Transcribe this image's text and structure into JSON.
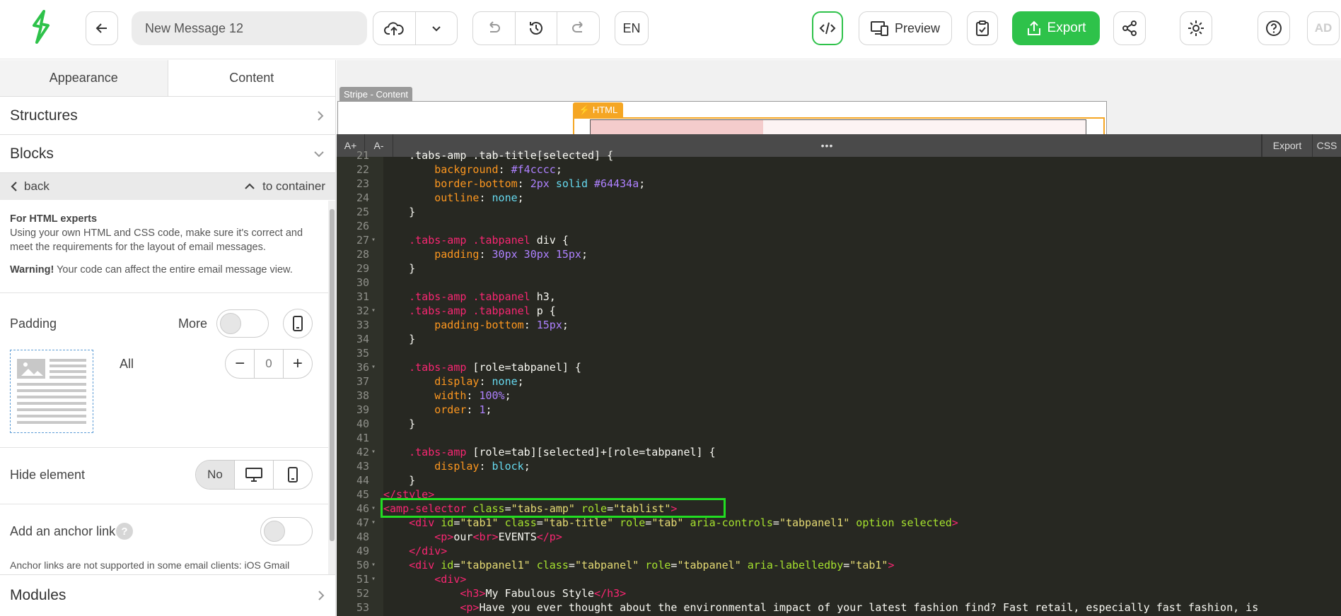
{
  "topbar": {
    "message_title": "New Message 12",
    "lang_label": "EN",
    "preview_label": "Preview",
    "export_label": "Export",
    "avatar_initials": "AD",
    "accent_color": "#2ec24a"
  },
  "panel": {
    "tabs": [
      "Appearance",
      "Content"
    ],
    "structures_label": "Structures",
    "blocks_label": "Blocks",
    "back_label": "back",
    "to_container_label": "to container",
    "info_title": "For HTML experts",
    "info_text": "Using your own HTML and CSS code, make sure it's correct and meet the requirements for the layout of email messages.",
    "warning_bold": "Warning!",
    "warning_text": " Your code can affect the entire email message view.",
    "padding_label": "Padding",
    "more_label": "More",
    "all_label": "All",
    "padding_value": "0",
    "hide_element_label": "Hide element",
    "hide_no_label": "No",
    "anchor_label": "Add an anchor link",
    "anchor_help": "?",
    "anchor_note": "Anchor links are not supported in some email clients: iOS Gmail",
    "modules_label": "Modules"
  },
  "canvas": {
    "stripe_tag": "Stripe - Content",
    "html_tag": "HTML"
  },
  "editor": {
    "font_up": "A+",
    "font_down": "A-",
    "dots": "•••",
    "export_btn": "Export",
    "css_btn": "CSS",
    "lines": [
      {
        "n": "21",
        "fold": "",
        "segs": [
          {
            "t": "    .tabs-amp .tab-title[selected] {",
            "c": "#f8f8f2"
          }
        ]
      },
      {
        "n": "22",
        "fold": "",
        "segs": [
          {
            "t": "        ",
            "c": "#f8f8f2"
          },
          {
            "t": "background",
            "c": "#fd971f"
          },
          {
            "t": ": ",
            "c": "#f8f8f2"
          },
          {
            "t": "#f4cccc",
            "c": "#ae81ff"
          },
          {
            "t": ";",
            "c": "#f8f8f2"
          }
        ]
      },
      {
        "n": "23",
        "fold": "",
        "segs": [
          {
            "t": "        ",
            "c": "#f8f8f2"
          },
          {
            "t": "border-bottom",
            "c": "#fd971f"
          },
          {
            "t": ": ",
            "c": "#f8f8f2"
          },
          {
            "t": "2px",
            "c": "#ae81ff"
          },
          {
            "t": " solid ",
            "c": "#66d9ef"
          },
          {
            "t": "#64434a",
            "c": "#ae81ff"
          },
          {
            "t": ";",
            "c": "#f8f8f2"
          }
        ]
      },
      {
        "n": "24",
        "fold": "",
        "segs": [
          {
            "t": "        ",
            "c": "#f8f8f2"
          },
          {
            "t": "outline",
            "c": "#fd971f"
          },
          {
            "t": ": ",
            "c": "#f8f8f2"
          },
          {
            "t": "none",
            "c": "#66d9ef"
          },
          {
            "t": ";",
            "c": "#f8f8f2"
          }
        ]
      },
      {
        "n": "25",
        "fold": "",
        "segs": [
          {
            "t": "    }",
            "c": "#f8f8f2"
          }
        ]
      },
      {
        "n": "26",
        "fold": "",
        "segs": [
          {
            "t": "",
            "c": "#f8f8f2"
          }
        ]
      },
      {
        "n": "27",
        "fold": "▾",
        "segs": [
          {
            "t": "    ",
            "c": "#f8f8f2"
          },
          {
            "t": ".tabs-amp",
            "c": "#f92672"
          },
          {
            "t": " ",
            "c": "#f8f8f2"
          },
          {
            "t": ".tabpanel",
            "c": "#f92672"
          },
          {
            "t": " div {",
            "c": "#f8f8f2"
          }
        ]
      },
      {
        "n": "28",
        "fold": "",
        "segs": [
          {
            "t": "        ",
            "c": "#f8f8f2"
          },
          {
            "t": "padding",
            "c": "#fd971f"
          },
          {
            "t": ": ",
            "c": "#f8f8f2"
          },
          {
            "t": "30px 30px 15px",
            "c": "#ae81ff"
          },
          {
            "t": ";",
            "c": "#f8f8f2"
          }
        ]
      },
      {
        "n": "29",
        "fold": "",
        "segs": [
          {
            "t": "    }",
            "c": "#f8f8f2"
          }
        ]
      },
      {
        "n": "30",
        "fold": "",
        "segs": [
          {
            "t": "",
            "c": "#f8f8f2"
          }
        ]
      },
      {
        "n": "31",
        "fold": "",
        "segs": [
          {
            "t": "    ",
            "c": "#f8f8f2"
          },
          {
            "t": ".tabs-amp",
            "c": "#f92672"
          },
          {
            "t": " ",
            "c": "#f8f8f2"
          },
          {
            "t": ".tabpanel",
            "c": "#f92672"
          },
          {
            "t": " h3,",
            "c": "#f8f8f2"
          }
        ]
      },
      {
        "n": "32",
        "fold": "▾",
        "segs": [
          {
            "t": "    ",
            "c": "#f8f8f2"
          },
          {
            "t": ".tabs-amp",
            "c": "#f92672"
          },
          {
            "t": " ",
            "c": "#f8f8f2"
          },
          {
            "t": ".tabpanel",
            "c": "#f92672"
          },
          {
            "t": " p {",
            "c": "#f8f8f2"
          }
        ]
      },
      {
        "n": "33",
        "fold": "",
        "segs": [
          {
            "t": "        ",
            "c": "#f8f8f2"
          },
          {
            "t": "padding-bottom",
            "c": "#fd971f"
          },
          {
            "t": ": ",
            "c": "#f8f8f2"
          },
          {
            "t": "15px",
            "c": "#ae81ff"
          },
          {
            "t": ";",
            "c": "#f8f8f2"
          }
        ]
      },
      {
        "n": "34",
        "fold": "",
        "segs": [
          {
            "t": "    }",
            "c": "#f8f8f2"
          }
        ]
      },
      {
        "n": "35",
        "fold": "",
        "segs": [
          {
            "t": "",
            "c": "#f8f8f2"
          }
        ]
      },
      {
        "n": "36",
        "fold": "▾",
        "segs": [
          {
            "t": "    ",
            "c": "#f8f8f2"
          },
          {
            "t": ".tabs-amp",
            "c": "#f92672"
          },
          {
            "t": " [role=tabpanel] {",
            "c": "#f8f8f2"
          }
        ]
      },
      {
        "n": "37",
        "fold": "",
        "segs": [
          {
            "t": "        ",
            "c": "#f8f8f2"
          },
          {
            "t": "display",
            "c": "#fd971f"
          },
          {
            "t": ": ",
            "c": "#f8f8f2"
          },
          {
            "t": "none",
            "c": "#66d9ef"
          },
          {
            "t": ";",
            "c": "#f8f8f2"
          }
        ]
      },
      {
        "n": "38",
        "fold": "",
        "segs": [
          {
            "t": "        ",
            "c": "#f8f8f2"
          },
          {
            "t": "width",
            "c": "#fd971f"
          },
          {
            "t": ": ",
            "c": "#f8f8f2"
          },
          {
            "t": "100%",
            "c": "#ae81ff"
          },
          {
            "t": ";",
            "c": "#f8f8f2"
          }
        ]
      },
      {
        "n": "39",
        "fold": "",
        "segs": [
          {
            "t": "        ",
            "c": "#f8f8f2"
          },
          {
            "t": "order",
            "c": "#fd971f"
          },
          {
            "t": ": ",
            "c": "#f8f8f2"
          },
          {
            "t": "1",
            "c": "#ae81ff"
          },
          {
            "t": ";",
            "c": "#f8f8f2"
          }
        ]
      },
      {
        "n": "40",
        "fold": "",
        "segs": [
          {
            "t": "    }",
            "c": "#f8f8f2"
          }
        ]
      },
      {
        "n": "41",
        "fold": "",
        "segs": [
          {
            "t": "",
            "c": "#f8f8f2"
          }
        ]
      },
      {
        "n": "42",
        "fold": "▾",
        "segs": [
          {
            "t": "    ",
            "c": "#f8f8f2"
          },
          {
            "t": ".tabs-amp",
            "c": "#f92672"
          },
          {
            "t": " [role=tab][selected]+[role=tabpanel] {",
            "c": "#f8f8f2"
          }
        ]
      },
      {
        "n": "43",
        "fold": "",
        "segs": [
          {
            "t": "        ",
            "c": "#f8f8f2"
          },
          {
            "t": "display",
            "c": "#fd971f"
          },
          {
            "t": ": ",
            "c": "#f8f8f2"
          },
          {
            "t": "block",
            "c": "#66d9ef"
          },
          {
            "t": ";",
            "c": "#f8f8f2"
          }
        ]
      },
      {
        "n": "44",
        "fold": "",
        "segs": [
          {
            "t": "    }",
            "c": "#f8f8f2"
          }
        ]
      },
      {
        "n": "45",
        "fold": "",
        "segs": [
          {
            "t": "</style>",
            "c": "#f92672"
          }
        ]
      },
      {
        "n": "46",
        "fold": "▾",
        "segs": [
          {
            "t": "<amp-selector",
            "c": "#f92672"
          },
          {
            "t": " class",
            "c": "#a6e22e"
          },
          {
            "t": "=",
            "c": "#f8f8f2"
          },
          {
            "t": "\"tabs-amp\"",
            "c": "#e6db74"
          },
          {
            "t": " role",
            "c": "#a6e22e"
          },
          {
            "t": "=",
            "c": "#f8f8f2"
          },
          {
            "t": "\"tablist\"",
            "c": "#e6db74"
          },
          {
            "t": ">",
            "c": "#f92672"
          }
        ]
      },
      {
        "n": "47",
        "fold": "▾",
        "segs": [
          {
            "t": "    ",
            "c": "#f8f8f2"
          },
          {
            "t": "<div",
            "c": "#f92672"
          },
          {
            "t": " id",
            "c": "#a6e22e"
          },
          {
            "t": "=",
            "c": "#f8f8f2"
          },
          {
            "t": "\"tab1\"",
            "c": "#e6db74"
          },
          {
            "t": " class",
            "c": "#a6e22e"
          },
          {
            "t": "=",
            "c": "#f8f8f2"
          },
          {
            "t": "\"tab-title\"",
            "c": "#e6db74"
          },
          {
            "t": " role",
            "c": "#a6e22e"
          },
          {
            "t": "=",
            "c": "#f8f8f2"
          },
          {
            "t": "\"tab\"",
            "c": "#e6db74"
          },
          {
            "t": " aria-controls",
            "c": "#a6e22e"
          },
          {
            "t": "=",
            "c": "#f8f8f2"
          },
          {
            "t": "\"tabpanel1\"",
            "c": "#e6db74"
          },
          {
            "t": " option selected",
            "c": "#a6e22e"
          },
          {
            "t": ">",
            "c": "#f92672"
          }
        ]
      },
      {
        "n": "48",
        "fold": "",
        "segs": [
          {
            "t": "        ",
            "c": "#f8f8f2"
          },
          {
            "t": "<p>",
            "c": "#f92672"
          },
          {
            "t": "our",
            "c": "#f8f8f2"
          },
          {
            "t": "<br>",
            "c": "#f92672"
          },
          {
            "t": "EVENTS",
            "c": "#f8f8f2"
          },
          {
            "t": "</p>",
            "c": "#f92672"
          }
        ]
      },
      {
        "n": "49",
        "fold": "",
        "segs": [
          {
            "t": "    ",
            "c": "#f8f8f2"
          },
          {
            "t": "</div>",
            "c": "#f92672"
          }
        ]
      },
      {
        "n": "50",
        "fold": "▾",
        "segs": [
          {
            "t": "    ",
            "c": "#f8f8f2"
          },
          {
            "t": "<div",
            "c": "#f92672"
          },
          {
            "t": " id",
            "c": "#a6e22e"
          },
          {
            "t": "=",
            "c": "#f8f8f2"
          },
          {
            "t": "\"tabpanel1\"",
            "c": "#e6db74"
          },
          {
            "t": " class",
            "c": "#a6e22e"
          },
          {
            "t": "=",
            "c": "#f8f8f2"
          },
          {
            "t": "\"tabpanel\"",
            "c": "#e6db74"
          },
          {
            "t": " role",
            "c": "#a6e22e"
          },
          {
            "t": "=",
            "c": "#f8f8f2"
          },
          {
            "t": "\"tabpanel\"",
            "c": "#e6db74"
          },
          {
            "t": " aria-labelledby",
            "c": "#a6e22e"
          },
          {
            "t": "=",
            "c": "#f8f8f2"
          },
          {
            "t": "\"tab1\"",
            "c": "#e6db74"
          },
          {
            "t": ">",
            "c": "#f92672"
          }
        ]
      },
      {
        "n": "51",
        "fold": "▾",
        "segs": [
          {
            "t": "        ",
            "c": "#f8f8f2"
          },
          {
            "t": "<div>",
            "c": "#f92672"
          }
        ]
      },
      {
        "n": "52",
        "fold": "",
        "segs": [
          {
            "t": "            ",
            "c": "#f8f8f2"
          },
          {
            "t": "<h3>",
            "c": "#f92672"
          },
          {
            "t": "My Fabulous Style",
            "c": "#f8f8f2"
          },
          {
            "t": "</h3>",
            "c": "#f92672"
          }
        ]
      },
      {
        "n": "53",
        "fold": "",
        "segs": [
          {
            "t": "            ",
            "c": "#f8f8f2"
          },
          {
            "t": "<p>",
            "c": "#f92672"
          },
          {
            "t": "Have you ever thought about the environmental impact of your latest fashion find? Fast retail, especially fast fashion, is",
            "c": "#f8f8f2"
          }
        ]
      }
    ]
  }
}
